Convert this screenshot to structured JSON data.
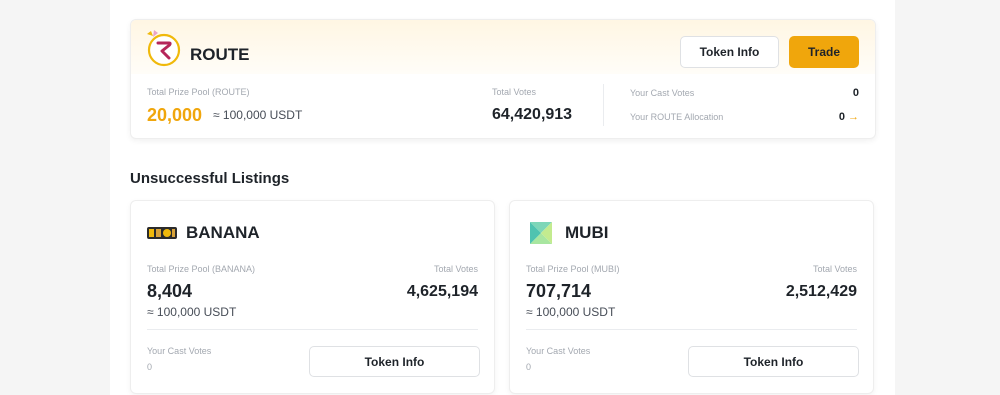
{
  "featured": {
    "token": "ROUTE",
    "buttons": {
      "token_info": "Token Info",
      "trade": "Trade"
    },
    "prize_pool_label": "Total Prize Pool (ROUTE)",
    "prize_pool_value": "20,000",
    "prize_pool_usdt": "≈ 100,000 USDT",
    "total_votes_label": "Total Votes",
    "total_votes_value": "64,420,913",
    "cast_votes_label": "Your Cast Votes",
    "cast_votes_value": "0",
    "allocation_label": "Your ROUTE Allocation",
    "allocation_value": "0",
    "colors": {
      "accent": "#f0a60c",
      "route_logo": "#b5265a"
    }
  },
  "section_title": "Unsuccessful Listings",
  "listings": [
    {
      "token": "BANANA",
      "prize_pool_label": "Total Prize Pool (BANANA)",
      "prize_pool_value": "8,404",
      "prize_pool_usdt": "≈ 100,000 USDT",
      "total_votes_label": "Total Votes",
      "total_votes_value": "4,625,194",
      "cast_votes_label": "Your Cast Votes",
      "cast_votes_value": "0",
      "token_info_label": "Token Info"
    },
    {
      "token": "MUBI",
      "prize_pool_label": "Total Prize Pool (MUBI)",
      "prize_pool_value": "707,714",
      "prize_pool_usdt": "≈ 100,000 USDT",
      "total_votes_label": "Total Votes",
      "total_votes_value": "2,512,429",
      "cast_votes_label": "Your Cast Votes",
      "cast_votes_value": "0",
      "token_info_label": "Token Info"
    }
  ]
}
